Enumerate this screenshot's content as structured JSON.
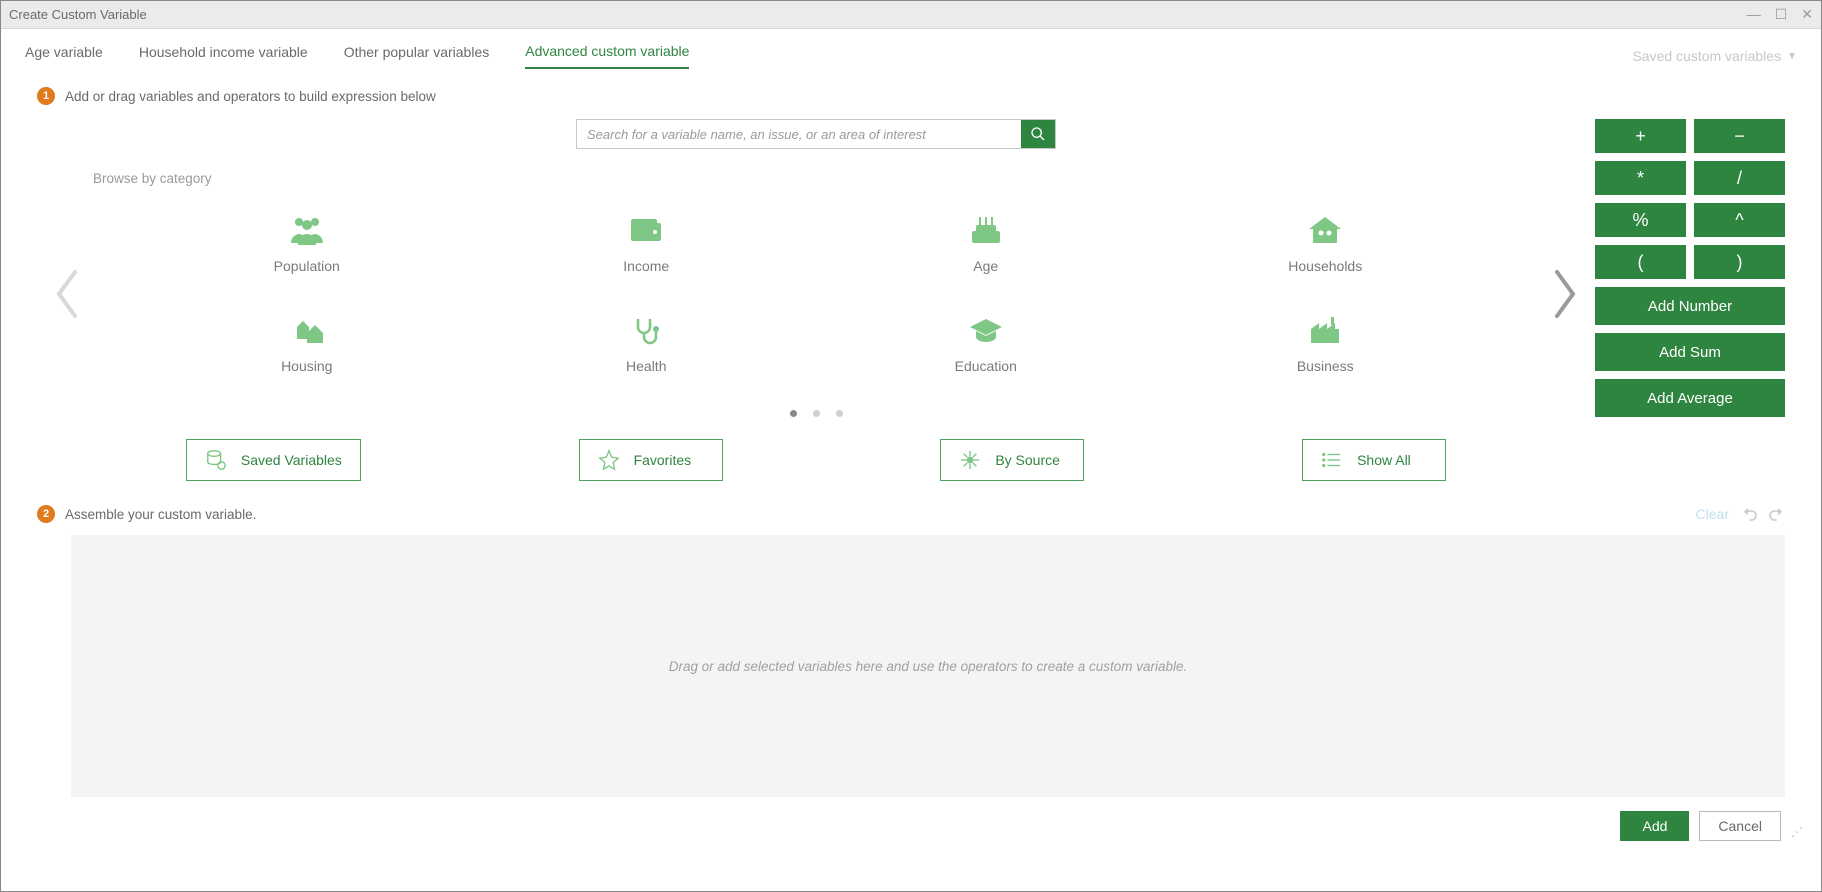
{
  "window": {
    "title": "Create Custom Variable"
  },
  "tabs": {
    "age": "Age variable",
    "household": "Household income variable",
    "other": "Other popular variables",
    "advanced": "Advanced custom variable",
    "saved_dropdown": "Saved custom variables"
  },
  "step1": {
    "num": "1",
    "text": "Add or drag variables and operators to build expression below"
  },
  "search": {
    "placeholder": "Search for a variable name, an issue, or an area of interest"
  },
  "browse_label": "Browse by category",
  "categories": [
    {
      "label": "Population"
    },
    {
      "label": "Income"
    },
    {
      "label": "Age"
    },
    {
      "label": "Households"
    },
    {
      "label": "Housing"
    },
    {
      "label": "Health"
    },
    {
      "label": "Education"
    },
    {
      "label": "Business"
    }
  ],
  "action_buttons": {
    "saved": "Saved Variables",
    "favorites": "Favorites",
    "bysource": "By Source",
    "showall": "Show All"
  },
  "operators": {
    "plus": "+",
    "minus": "−",
    "mult": "*",
    "div": "/",
    "pct": "%",
    "pow": "^",
    "lparen": "(",
    "rparen": ")",
    "add_number": "Add Number",
    "add_sum": "Add Sum",
    "add_average": "Add Average"
  },
  "step2": {
    "num": "2",
    "text": "Assemble your custom variable.",
    "clear": "Clear",
    "drop_hint": "Drag or add selected variables here and use the operators to create a custom variable."
  },
  "footer": {
    "add": "Add",
    "cancel": "Cancel"
  }
}
